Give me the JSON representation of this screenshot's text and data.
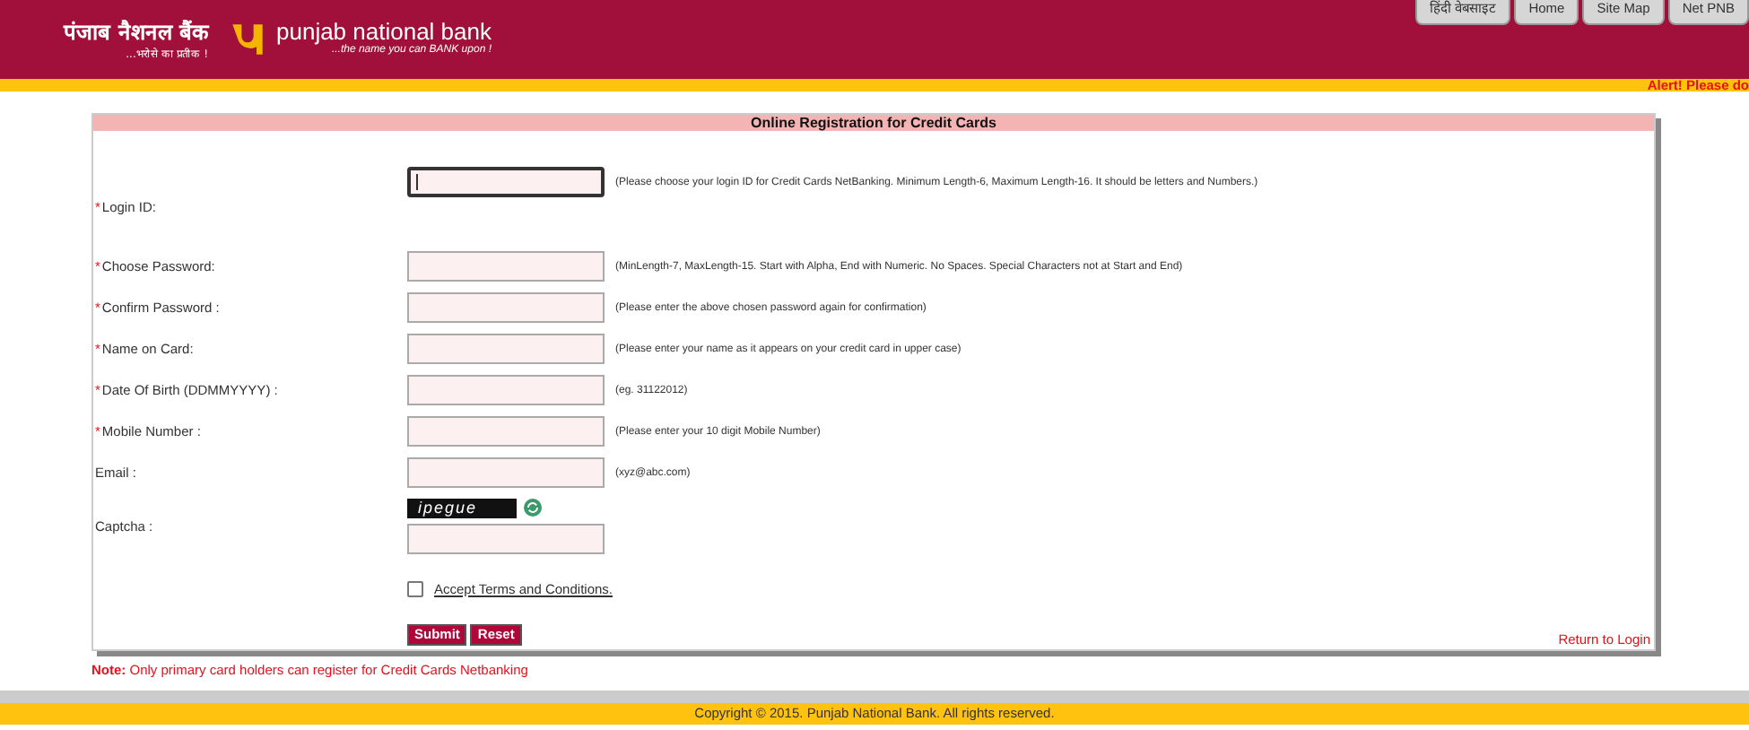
{
  "header": {
    "brand_hindi": "पंजाब नैशनल बैंक",
    "tagline_hindi": "...भरोसे का प्रतीक !",
    "brand": "punjab national bank",
    "tagline": "...the name you can BANK upon !",
    "nav": [
      {
        "label": "हिंदी वेबसाइट"
      },
      {
        "label": "Home"
      },
      {
        "label": "Site Map"
      },
      {
        "label": "Net PNB"
      }
    ],
    "alert": "Alert! Please do"
  },
  "form": {
    "title": "Online Registration for Credit Cards",
    "fields": [
      {
        "kind": "text",
        "label": "Login ID:",
        "required": true,
        "focused": true,
        "hint": "(Please choose your login ID for Credit Cards NetBanking. Minimum Length-6, Maximum Length-16. It should be letters and Numbers.)"
      },
      {
        "kind": "text",
        "label": "Choose Password:",
        "required": true,
        "focused": false,
        "hint": "(MinLength-7, MaxLength-15. Start with Alpha, End with Numeric. No Spaces. Special Characters not at Start and End)"
      },
      {
        "kind": "text",
        "label": "Confirm Password :",
        "required": true,
        "focused": false,
        "hint": "(Please enter the above chosen password again for confirmation)"
      },
      {
        "kind": "text",
        "label": "Name on Card:",
        "required": true,
        "focused": false,
        "hint": "(Please enter your name as it appears on your credit card in upper case)"
      },
      {
        "kind": "text",
        "label": "Date Of Birth (DDMMYYYY) :",
        "required": true,
        "focused": false,
        "hint": "(eg. 31122012)"
      },
      {
        "kind": "text",
        "label": "Mobile Number :",
        "required": true,
        "focused": false,
        "hint": "(Please enter your 10 digit Mobile Number)"
      },
      {
        "kind": "text",
        "label": "Email :",
        "required": false,
        "focused": false,
        "hint": "(xyz@abc.com)"
      },
      {
        "kind": "captcha",
        "label": "Captcha :",
        "captcha_text": "ipegue"
      }
    ],
    "required_mark": "*",
    "terms": {
      "label": "Accept Terms and Conditions.",
      "checked": false
    },
    "buttons": [
      "Submit",
      "Reset"
    ],
    "return_link": "Return to Login"
  },
  "note": {
    "prefix": "Note:",
    "text": "Only primary card holders can register for Credit Cards Netbanking"
  },
  "footer": "Copyright © 2015. Punjab National Bank. All rights reserved."
}
